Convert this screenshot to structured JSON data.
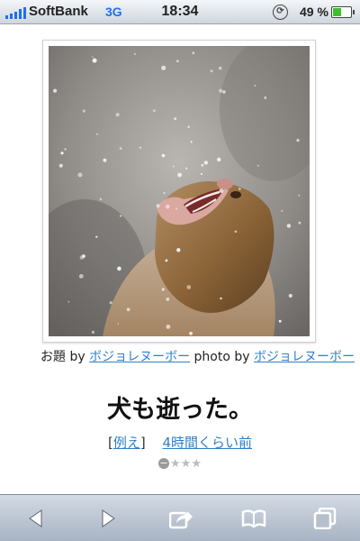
{
  "status_bar": {
    "carrier": "SoftBank",
    "network": "3G",
    "time": "18:34",
    "battery_percent_label": "49 %",
    "battery_level": 0.49,
    "icons": [
      "signal-bars-icon",
      "orientation-lock-icon",
      "battery-icon"
    ]
  },
  "post": {
    "image_description_icon": "snow-monkey-photo",
    "caption": {
      "odai_prefix": "お題 by",
      "odai_author": "ボジョレヌーボー",
      "photo_prefix": "photo by",
      "photo_author": "ボジョレヌーボー"
    },
    "headline": "犬も逝った。",
    "example_open": "[",
    "example_label": "例え",
    "example_close": "]",
    "time_ago": "4時間くらい前",
    "rating_minus": "−",
    "rating_stars": "★★★",
    "rating_value": 0
  },
  "toolbar": {
    "icons": [
      "back-arrow-icon",
      "forward-arrow-icon",
      "share-icon",
      "bookmarks-icon",
      "tabs-icon"
    ]
  },
  "colors": {
    "link": "#2f7fc8",
    "status_blue": "#1d6ff2",
    "battery_green": "#3fbf2f"
  }
}
